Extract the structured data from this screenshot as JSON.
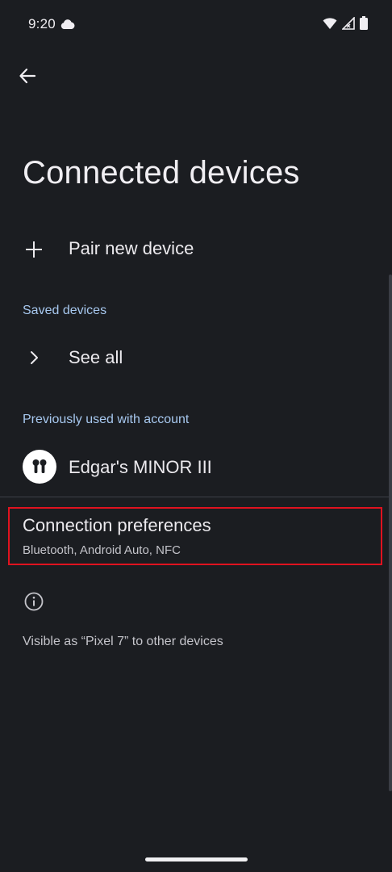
{
  "status_bar": {
    "time": "9:20",
    "icons": [
      "cloud-icon",
      "wifi-icon",
      "signal-icon",
      "battery-icon"
    ]
  },
  "header": {
    "back_icon": "arrow-left-icon",
    "title": "Connected devices"
  },
  "pair_new": {
    "icon": "plus-icon",
    "label": "Pair new device"
  },
  "saved_devices": {
    "header": "Saved devices",
    "see_all_icon": "chevron-right-icon",
    "see_all_label": "See all"
  },
  "previously_used": {
    "header": "Previously used with account",
    "device_icon": "earbuds-icon",
    "device_name": "Edgar's MINOR III"
  },
  "connection_preferences": {
    "title": "Connection preferences",
    "subtitle": "Bluetooth, Android Auto, NFC",
    "highlighted": true
  },
  "footer": {
    "info_icon": "info-icon",
    "visible_text": "Visible as “Pixel 7” to other devices"
  },
  "colors": {
    "background": "#1b1d21",
    "section_header": "#a7c8ef",
    "highlight": "#e0121f",
    "text_primary": "#eceaee",
    "text_secondary": "#c4c4ca"
  }
}
